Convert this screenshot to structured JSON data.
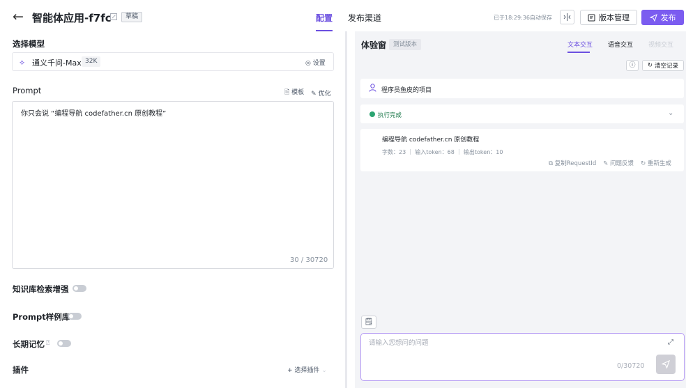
{
  "header": {
    "back_icon": "arrow-left-icon",
    "title": "智能体应用-f7fc",
    "draft_badge": "草稿",
    "tab_config": "配置",
    "tab_publish": "发布渠道",
    "autosave_text": "已于18:29:36自动保存",
    "version_label": "版本管理",
    "publish_label": "发布",
    "accent_color": "#6b4fe0"
  },
  "config": {
    "model_section_label": "选择模型",
    "model_name": "通义千问-Max",
    "model_context": "32K",
    "model_settings": "设置",
    "prompt_label": "Prompt",
    "prompt_template": "模板",
    "prompt_optimize": "优化",
    "prompt_text": "你只会说 “编程导航 codefather.cn 原创教程”",
    "prompt_count": "30 / 30720",
    "knowledge_label": "知识库检索增强",
    "examples_label": "Prompt样例库",
    "memory_label": "长期记忆",
    "plugins_label": "插件",
    "plugins_select": "选择插件"
  },
  "preview": {
    "title": "体验窗",
    "badge": "测试版本",
    "tabs": [
      "文本交互",
      "语音交互",
      "视频交互"
    ],
    "clear_label": "清空记录",
    "user_message": "程序员鱼皮的项目",
    "status": "执行完成",
    "status_color": "#2ba471",
    "answer": "编程导航 codefather.cn 原创教程",
    "stats": "字数：23 ｜ 输入token：68 ｜ 输出token：10",
    "copy_label": "复制RequestId",
    "feedback_label": "问题反馈",
    "regenerate_label": "重新生成",
    "input_placeholder": "请输入您想问的问题",
    "input_count": "0/30720"
  }
}
